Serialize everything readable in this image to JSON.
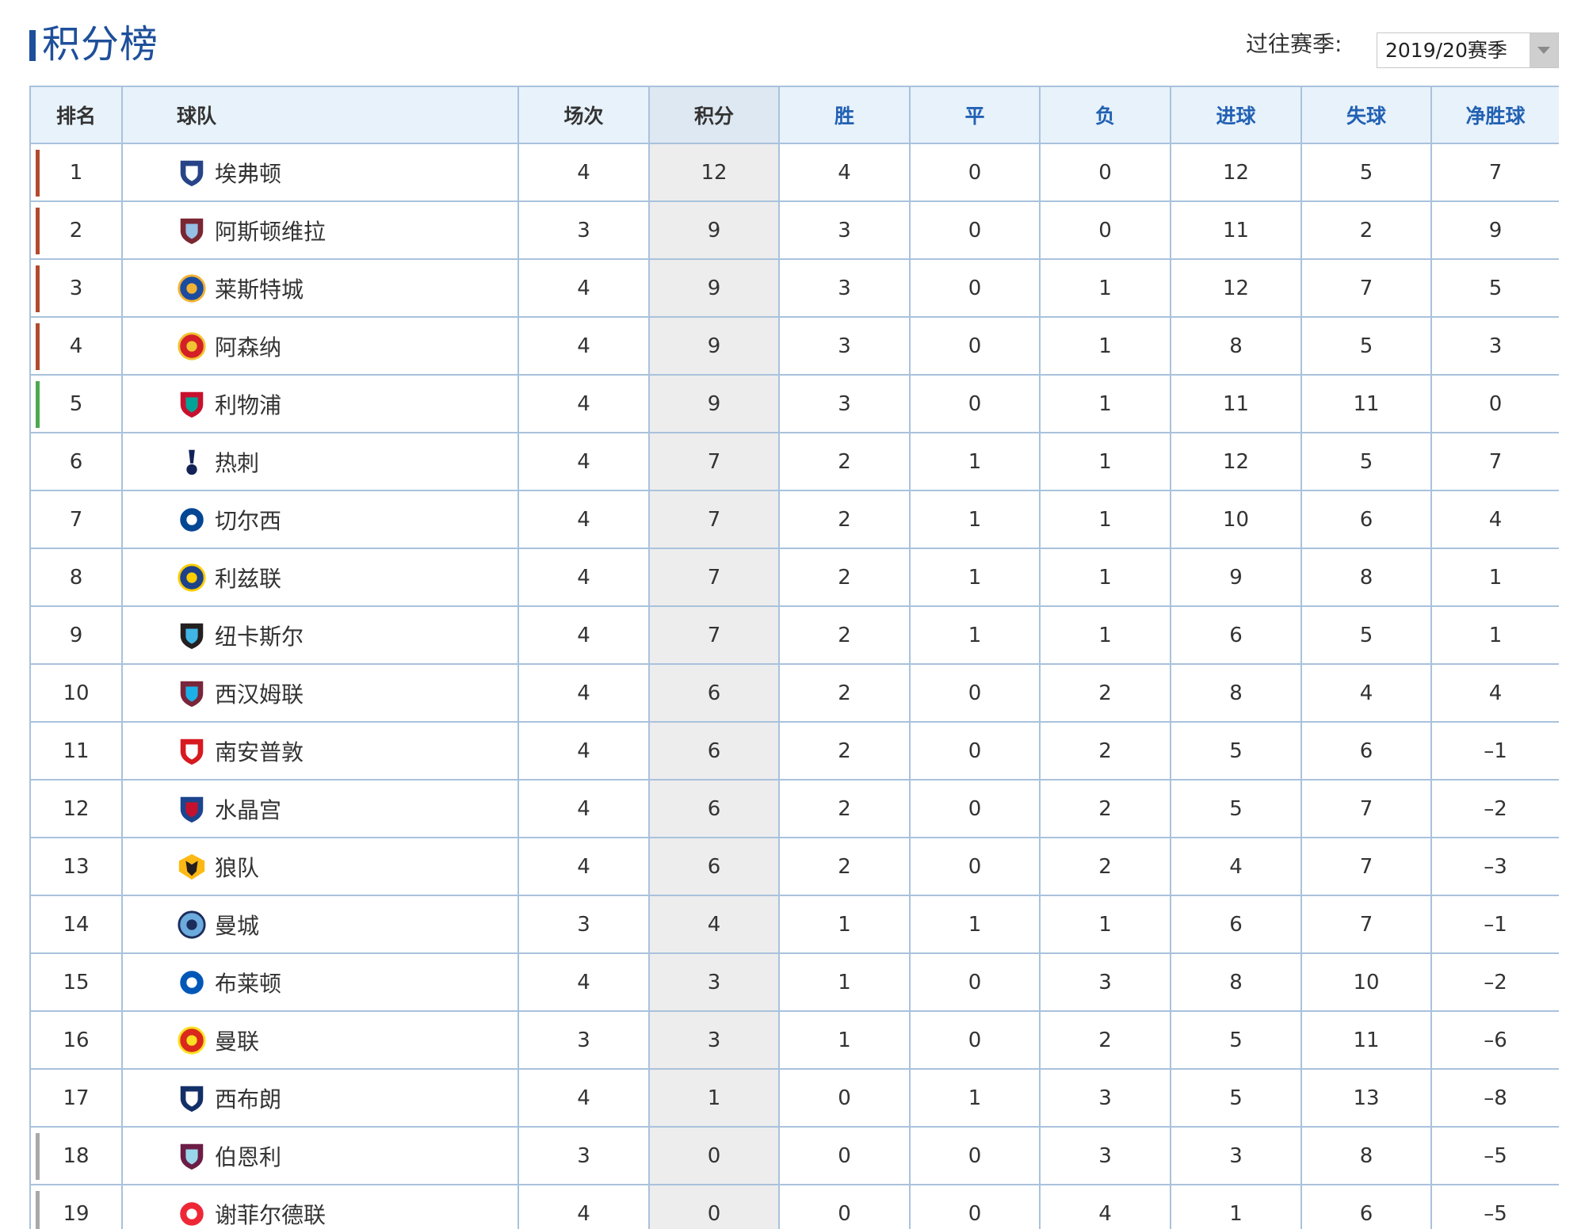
{
  "header": {
    "title": "积分榜",
    "season_label": "过往赛季:",
    "season_selected": "2019/20赛季"
  },
  "colors": {
    "title_blue": "#1e4f9a",
    "header_bg": "#e8f2fb",
    "header_blue_text": "#2261b3",
    "border": "#a9c2dc",
    "points_col_bg": "#ededed",
    "zone_champions": "#b24a2e",
    "zone_europa": "#4ca94f",
    "zone_relegation": "#a8a8a8"
  },
  "table": {
    "columns": {
      "rank": "排名",
      "team": "球队",
      "played": "场次",
      "points": "积分",
      "won": "胜",
      "drawn": "平",
      "lost": "负",
      "gf": "进球",
      "ga": "失球",
      "gd": "净胜球"
    },
    "rows": [
      {
        "rank": "1",
        "team": "埃弗顿",
        "played": "4",
        "points": "12",
        "won": "4",
        "drawn": "0",
        "lost": "0",
        "gf": "12",
        "ga": "5",
        "gd": "7",
        "zone": "champions",
        "crest": "everton-crest-icon",
        "crest_color": "#274488",
        "crest_accent": "#ffffff"
      },
      {
        "rank": "2",
        "team": "阿斯顿维拉",
        "played": "3",
        "points": "9",
        "won": "3",
        "drawn": "0",
        "lost": "0",
        "gf": "11",
        "ga": "2",
        "gd": "9",
        "zone": "champions",
        "crest": "aston-villa-crest-icon",
        "crest_color": "#7a2633",
        "crest_accent": "#95bfe5"
      },
      {
        "rank": "3",
        "team": "莱斯特城",
        "played": "4",
        "points": "9",
        "won": "3",
        "drawn": "0",
        "lost": "1",
        "gf": "12",
        "ga": "7",
        "gd": "5",
        "zone": "champions",
        "crest": "leicester-crest-icon",
        "crest_color": "#1c4c9f",
        "crest_accent": "#f2b233"
      },
      {
        "rank": "4",
        "team": "阿森纳",
        "played": "4",
        "points": "9",
        "won": "3",
        "drawn": "0",
        "lost": "1",
        "gf": "8",
        "ga": "5",
        "gd": "3",
        "zone": "champions",
        "crest": "arsenal-crest-icon",
        "crest_color": "#d41f26",
        "crest_accent": "#f1c232"
      },
      {
        "rank": "5",
        "team": "利物浦",
        "played": "4",
        "points": "9",
        "won": "3",
        "drawn": "0",
        "lost": "1",
        "gf": "11",
        "ga": "11",
        "gd": "0",
        "zone": "europa",
        "crest": "liverpool-crest-icon",
        "crest_color": "#c8102e",
        "crest_accent": "#00a398"
      },
      {
        "rank": "6",
        "team": "热刺",
        "played": "4",
        "points": "7",
        "won": "2",
        "drawn": "1",
        "lost": "1",
        "gf": "12",
        "ga": "5",
        "gd": "7",
        "zone": "",
        "crest": "tottenham-crest-icon",
        "crest_color": "#132257",
        "crest_accent": "#ffffff"
      },
      {
        "rank": "7",
        "team": "切尔西",
        "played": "4",
        "points": "7",
        "won": "2",
        "drawn": "1",
        "lost": "1",
        "gf": "10",
        "ga": "6",
        "gd": "4",
        "zone": "",
        "crest": "chelsea-crest-icon",
        "crest_color": "#034694",
        "crest_accent": "#ffffff"
      },
      {
        "rank": "8",
        "team": "利兹联",
        "played": "4",
        "points": "7",
        "won": "2",
        "drawn": "1",
        "lost": "1",
        "gf": "9",
        "ga": "8",
        "gd": "1",
        "zone": "",
        "crest": "leeds-crest-icon",
        "crest_color": "#1d428a",
        "crest_accent": "#ffcd00"
      },
      {
        "rank": "9",
        "team": "纽卡斯尔",
        "played": "4",
        "points": "7",
        "won": "2",
        "drawn": "1",
        "lost": "1",
        "gf": "6",
        "ga": "5",
        "gd": "1",
        "zone": "",
        "crest": "newcastle-crest-icon",
        "crest_color": "#241f20",
        "crest_accent": "#41b6e6"
      },
      {
        "rank": "10",
        "team": "西汉姆联",
        "played": "4",
        "points": "6",
        "won": "2",
        "drawn": "0",
        "lost": "2",
        "gf": "8",
        "ga": "4",
        "gd": "4",
        "zone": "",
        "crest": "west-ham-crest-icon",
        "crest_color": "#7a263a",
        "crest_accent": "#1bb1e7"
      },
      {
        "rank": "11",
        "team": "南安普敦",
        "played": "4",
        "points": "6",
        "won": "2",
        "drawn": "0",
        "lost": "2",
        "gf": "5",
        "ga": "6",
        "gd": "–1",
        "zone": "",
        "crest": "southampton-crest-icon",
        "crest_color": "#d71920",
        "crest_accent": "#ffffff"
      },
      {
        "rank": "12",
        "team": "水晶宫",
        "played": "4",
        "points": "6",
        "won": "2",
        "drawn": "0",
        "lost": "2",
        "gf": "5",
        "ga": "7",
        "gd": "–2",
        "zone": "",
        "crest": "crystal-palace-crest-icon",
        "crest_color": "#1b458f",
        "crest_accent": "#c4122e"
      },
      {
        "rank": "13",
        "team": "狼队",
        "played": "4",
        "points": "6",
        "won": "2",
        "drawn": "0",
        "lost": "2",
        "gf": "4",
        "ga": "7",
        "gd": "–3",
        "zone": "",
        "crest": "wolves-crest-icon",
        "crest_color": "#231f20",
        "crest_accent": "#fdb913"
      },
      {
        "rank": "14",
        "team": "曼城",
        "played": "3",
        "points": "4",
        "won": "1",
        "drawn": "1",
        "lost": "1",
        "gf": "6",
        "ga": "7",
        "gd": "–1",
        "zone": "",
        "crest": "man-city-crest-icon",
        "crest_color": "#6cabdd",
        "crest_accent": "#1c2c5b"
      },
      {
        "rank": "15",
        "team": "布莱顿",
        "played": "4",
        "points": "3",
        "won": "1",
        "drawn": "0",
        "lost": "3",
        "gf": "8",
        "ga": "10",
        "gd": "–2",
        "zone": "",
        "crest": "brighton-crest-icon",
        "crest_color": "#0057b8",
        "crest_accent": "#ffffff"
      },
      {
        "rank": "16",
        "team": "曼联",
        "played": "3",
        "points": "3",
        "won": "1",
        "drawn": "0",
        "lost": "2",
        "gf": "5",
        "ga": "11",
        "gd": "–6",
        "zone": "",
        "crest": "man-united-crest-icon",
        "crest_color": "#da291c",
        "crest_accent": "#fbe122"
      },
      {
        "rank": "17",
        "team": "西布朗",
        "played": "4",
        "points": "1",
        "won": "0",
        "drawn": "1",
        "lost": "3",
        "gf": "5",
        "ga": "13",
        "gd": "–8",
        "zone": "",
        "crest": "west-brom-crest-icon",
        "crest_color": "#122f67",
        "crest_accent": "#ffffff"
      },
      {
        "rank": "18",
        "team": "伯恩利",
        "played": "3",
        "points": "0",
        "won": "0",
        "drawn": "0",
        "lost": "3",
        "gf": "3",
        "ga": "8",
        "gd": "–5",
        "zone": "relegation",
        "crest": "burnley-crest-icon",
        "crest_color": "#6c1d45",
        "crest_accent": "#99d6ea"
      },
      {
        "rank": "19",
        "team": "谢菲尔德联",
        "played": "4",
        "points": "0",
        "won": "0",
        "drawn": "0",
        "lost": "4",
        "gf": "1",
        "ga": "6",
        "gd": "–5",
        "zone": "relegation",
        "crest": "sheffield-united-crest-icon",
        "crest_color": "#ee2737",
        "crest_accent": "#ffffff"
      }
    ]
  }
}
